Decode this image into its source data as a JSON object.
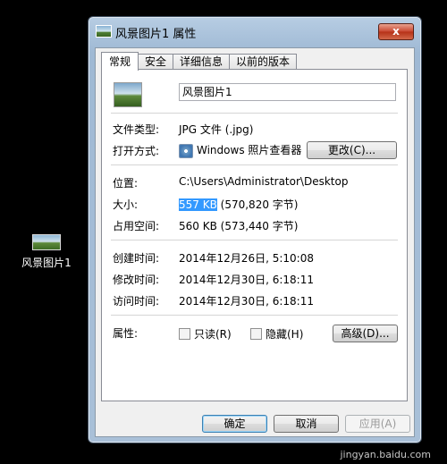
{
  "desktop": {
    "icon_label": "风景图片1"
  },
  "window": {
    "title": "风景图片1 属性",
    "close_label": "x",
    "tabs": [
      "常规",
      "安全",
      "详细信息",
      "以前的版本"
    ]
  },
  "general": {
    "file_name": "风景图片1",
    "file_type_label": "文件类型:",
    "file_type_value": "JPG 文件 (.jpg)",
    "opens_with_label": "打开方式:",
    "opens_with_value": "Windows 照片查看器",
    "change_button": "更改(C)...",
    "location_label": "位置:",
    "location_value": "C:\\Users\\Administrator\\Desktop",
    "size_label": "大小:",
    "size_highlight": "557 KB",
    "size_rest": "(570,820 字节)",
    "size_on_disk_label": "占用空间:",
    "size_on_disk_value": "560 KB (573,440 字节)",
    "created_label": "创建时间:",
    "created_value": "2014年12月26日, 5:10:08",
    "modified_label": "修改时间:",
    "modified_value": "2014年12月30日, 6:18:11",
    "accessed_label": "访问时间:",
    "accessed_value": "2014年12月30日, 6:18:11",
    "attributes_label": "属性:",
    "readonly_label": "只读(R)",
    "hidden_label": "隐藏(H)",
    "advanced_button": "高级(D)..."
  },
  "footer": {
    "ok": "确定",
    "cancel": "取消",
    "apply": "应用(A)"
  },
  "watermark": "jingyan.baidu.com"
}
